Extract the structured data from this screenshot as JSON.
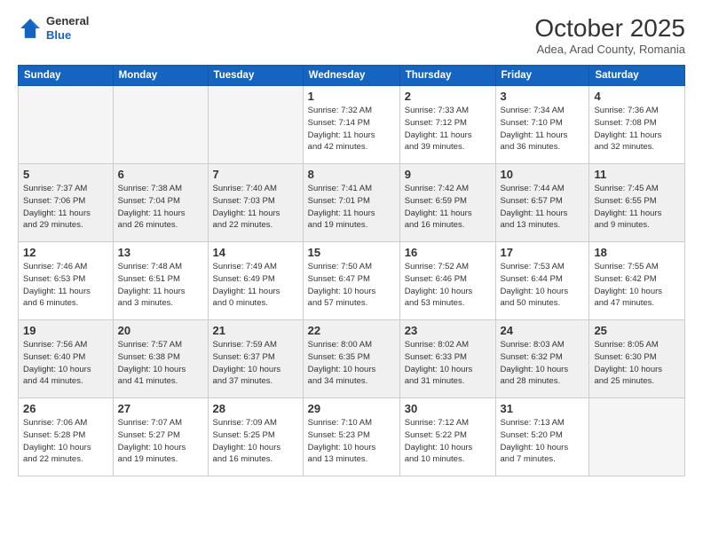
{
  "header": {
    "logo": {
      "general": "General",
      "blue": "Blue"
    },
    "title": "October 2025",
    "subtitle": "Adea, Arad County, Romania"
  },
  "weekdays": [
    "Sunday",
    "Monday",
    "Tuesday",
    "Wednesday",
    "Thursday",
    "Friday",
    "Saturday"
  ],
  "weeks": [
    [
      {
        "num": "",
        "info": ""
      },
      {
        "num": "",
        "info": ""
      },
      {
        "num": "",
        "info": ""
      },
      {
        "num": "1",
        "info": "Sunrise: 7:32 AM\nSunset: 7:14 PM\nDaylight: 11 hours\nand 42 minutes."
      },
      {
        "num": "2",
        "info": "Sunrise: 7:33 AM\nSunset: 7:12 PM\nDaylight: 11 hours\nand 39 minutes."
      },
      {
        "num": "3",
        "info": "Sunrise: 7:34 AM\nSunset: 7:10 PM\nDaylight: 11 hours\nand 36 minutes."
      },
      {
        "num": "4",
        "info": "Sunrise: 7:36 AM\nSunset: 7:08 PM\nDaylight: 11 hours\nand 32 minutes."
      }
    ],
    [
      {
        "num": "5",
        "info": "Sunrise: 7:37 AM\nSunset: 7:06 PM\nDaylight: 11 hours\nand 29 minutes."
      },
      {
        "num": "6",
        "info": "Sunrise: 7:38 AM\nSunset: 7:04 PM\nDaylight: 11 hours\nand 26 minutes."
      },
      {
        "num": "7",
        "info": "Sunrise: 7:40 AM\nSunset: 7:03 PM\nDaylight: 11 hours\nand 22 minutes."
      },
      {
        "num": "8",
        "info": "Sunrise: 7:41 AM\nSunset: 7:01 PM\nDaylight: 11 hours\nand 19 minutes."
      },
      {
        "num": "9",
        "info": "Sunrise: 7:42 AM\nSunset: 6:59 PM\nDaylight: 11 hours\nand 16 minutes."
      },
      {
        "num": "10",
        "info": "Sunrise: 7:44 AM\nSunset: 6:57 PM\nDaylight: 11 hours\nand 13 minutes."
      },
      {
        "num": "11",
        "info": "Sunrise: 7:45 AM\nSunset: 6:55 PM\nDaylight: 11 hours\nand 9 minutes."
      }
    ],
    [
      {
        "num": "12",
        "info": "Sunrise: 7:46 AM\nSunset: 6:53 PM\nDaylight: 11 hours\nand 6 minutes."
      },
      {
        "num": "13",
        "info": "Sunrise: 7:48 AM\nSunset: 6:51 PM\nDaylight: 11 hours\nand 3 minutes."
      },
      {
        "num": "14",
        "info": "Sunrise: 7:49 AM\nSunset: 6:49 PM\nDaylight: 11 hours\nand 0 minutes."
      },
      {
        "num": "15",
        "info": "Sunrise: 7:50 AM\nSunset: 6:47 PM\nDaylight: 10 hours\nand 57 minutes."
      },
      {
        "num": "16",
        "info": "Sunrise: 7:52 AM\nSunset: 6:46 PM\nDaylight: 10 hours\nand 53 minutes."
      },
      {
        "num": "17",
        "info": "Sunrise: 7:53 AM\nSunset: 6:44 PM\nDaylight: 10 hours\nand 50 minutes."
      },
      {
        "num": "18",
        "info": "Sunrise: 7:55 AM\nSunset: 6:42 PM\nDaylight: 10 hours\nand 47 minutes."
      }
    ],
    [
      {
        "num": "19",
        "info": "Sunrise: 7:56 AM\nSunset: 6:40 PM\nDaylight: 10 hours\nand 44 minutes."
      },
      {
        "num": "20",
        "info": "Sunrise: 7:57 AM\nSunset: 6:38 PM\nDaylight: 10 hours\nand 41 minutes."
      },
      {
        "num": "21",
        "info": "Sunrise: 7:59 AM\nSunset: 6:37 PM\nDaylight: 10 hours\nand 37 minutes."
      },
      {
        "num": "22",
        "info": "Sunrise: 8:00 AM\nSunset: 6:35 PM\nDaylight: 10 hours\nand 34 minutes."
      },
      {
        "num": "23",
        "info": "Sunrise: 8:02 AM\nSunset: 6:33 PM\nDaylight: 10 hours\nand 31 minutes."
      },
      {
        "num": "24",
        "info": "Sunrise: 8:03 AM\nSunset: 6:32 PM\nDaylight: 10 hours\nand 28 minutes."
      },
      {
        "num": "25",
        "info": "Sunrise: 8:05 AM\nSunset: 6:30 PM\nDaylight: 10 hours\nand 25 minutes."
      }
    ],
    [
      {
        "num": "26",
        "info": "Sunrise: 7:06 AM\nSunset: 5:28 PM\nDaylight: 10 hours\nand 22 minutes."
      },
      {
        "num": "27",
        "info": "Sunrise: 7:07 AM\nSunset: 5:27 PM\nDaylight: 10 hours\nand 19 minutes."
      },
      {
        "num": "28",
        "info": "Sunrise: 7:09 AM\nSunset: 5:25 PM\nDaylight: 10 hours\nand 16 minutes."
      },
      {
        "num": "29",
        "info": "Sunrise: 7:10 AM\nSunset: 5:23 PM\nDaylight: 10 hours\nand 13 minutes."
      },
      {
        "num": "30",
        "info": "Sunrise: 7:12 AM\nSunset: 5:22 PM\nDaylight: 10 hours\nand 10 minutes."
      },
      {
        "num": "31",
        "info": "Sunrise: 7:13 AM\nSunset: 5:20 PM\nDaylight: 10 hours\nand 7 minutes."
      },
      {
        "num": "",
        "info": ""
      }
    ]
  ]
}
